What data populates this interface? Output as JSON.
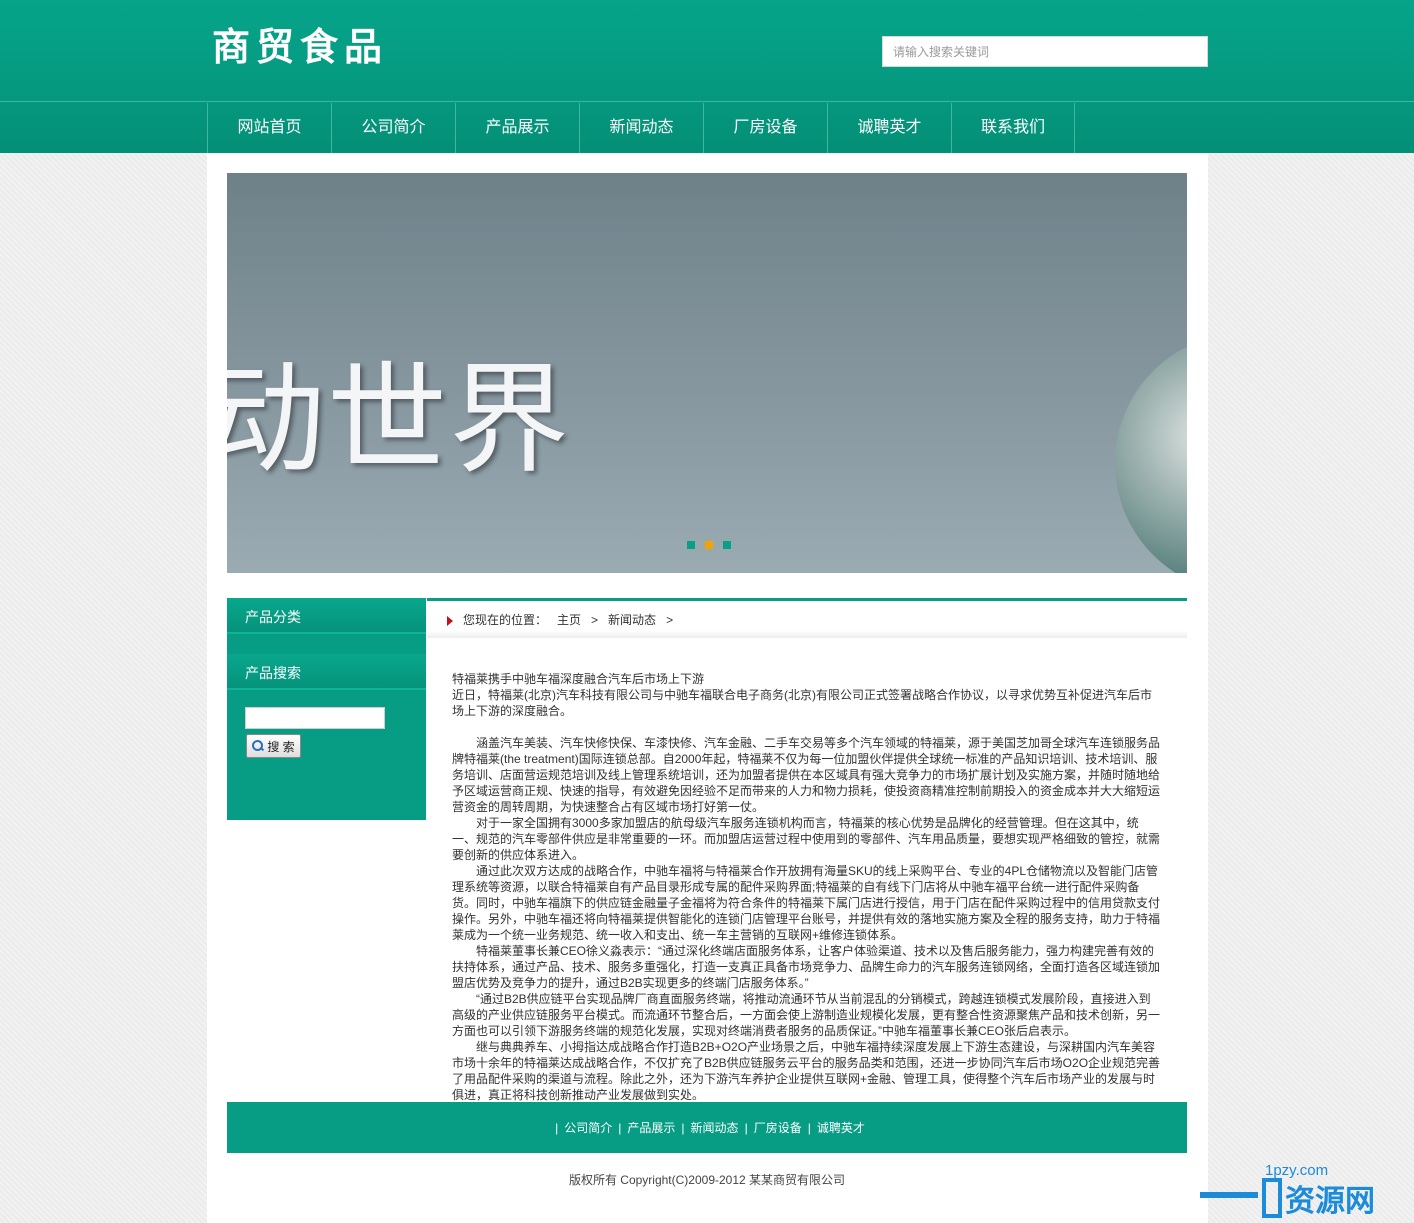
{
  "header": {
    "logo": "商贸食品",
    "search_placeholder": "请输入搜索关键词"
  },
  "nav": [
    "网站首页",
    "公司简介",
    "产品展示",
    "新闻动态",
    "厂房设备",
    "诚聘英才",
    "联系我们"
  ],
  "banner": {
    "text": "动世界",
    "slides": 3,
    "active_slide": 2
  },
  "sidebar": {
    "category_title": "产品分类",
    "search_title": "产品搜索",
    "search_button": "搜 索"
  },
  "breadcrumb": {
    "prefix": "您现在的位置：",
    "home": "主页",
    "sep1": ">",
    "section": "新闻动态",
    "sep2": ">"
  },
  "article": {
    "title": "特福莱携手中驰车福深度融合汽车后市场上下游",
    "lead": "近日，特福莱(北京)汽车科技有限公司与中驰车福联合电子商务(北京)有限公司正式签署战略合作协议，以寻求优势互补促进汽车后市场上下游的深度融合。",
    "p1": "涵盖汽车美装、汽车快修快保、车漆快修、汽车金融、二手车交易等多个汽车领域的特福莱，源于美国芝加哥全球汽车连锁服务品牌特福莱(the treatment)国际连锁总部。自2000年起，特福莱不仅为每一位加盟伙伴提供全球统一标准的产品知识培训、技术培训、服务培训、店面营运规范培训及线上管理系统培训，还为加盟者提供在本区域具有强大竞争力的市场扩展计划及实施方案，并随时随地给予区域运营商正规、快速的指导，有效避免因经验不足而带来的人力和物力损耗，使投资商精准控制前期投入的资金成本并大大缩短运营资金的周转周期，为快速整合占有区域市场打好第一仗。",
    "p2": "对于一家全国拥有3000多家加盟店的航母级汽车服务连锁机构而言，特福莱的核心优势是品牌化的经营管理。但在这其中，统一、规范的汽车零部件供应是非常重要的一环。而加盟店运营过程中使用到的零部件、汽车用品质量，要想实现严格细致的管控，就需要创新的供应体系进入。",
    "p3": "通过此次双方达成的战略合作，中驰车福将与特福莱合作开放拥有海量SKU的线上采购平台、专业的4PL仓储物流以及智能门店管理系统等资源，以联合特福莱自有产品目录形成专属的配件采购界面;特福莱的自有线下门店将从中驰车福平台统一进行配件采购备货。同时，中驰车福旗下的供应链金融量子金福将为符合条件的特福莱下属门店进行授信，用于门店在配件采购过程中的信用贷款支付操作。另外，中驰车福还将向特福莱提供智能化的连锁门店管理平台账号，并提供有效的落地实施方案及全程的服务支持，助力于特福莱成为一个统一业务规范、统一收入和支出、统一车主营销的互联网+维修连锁体系。",
    "p4": "特福莱董事长兼CEO徐义淼表示：“通过深化终端店面服务体系，让客户体验渠道、技术以及售后服务能力，强力构建完善有效的扶持体系，通过产品、技术、服务多重强化，打造一支真正具备市场竞争力、品牌生命力的汽车服务连锁网络，全面打造各区域连锁加盟店优势及竞争力的提升，通过B2B实现更多的终端门店服务体系。”",
    "p5": "“通过B2B供应链平台实现品牌厂商直面服务终端，将推动流通环节从当前混乱的分销模式，跨越连锁模式发展阶段，直接进入到高级的产业供应链服务平台模式。而流通环节整合后，一方面会使上游制造业规模化发展，更有整合性资源聚焦产品和技术创新，另一方面也可以引领下游服务终端的规范化发展，实现对终端消费者服务的品质保证。”中驰车福董事长兼CEO张后启表示。",
    "p6": "继与典典养车、小拇指达成战略合作打造B2B+O2O产业场景之后，中驰车福持续深度发展上下游生态建设，与深耕国内汽车美容市场十余年的特福莱达成战略合作，不仅扩充了B2B供应链服务云平台的服务品类和范围，还进一步协同汽车后市场O2O企业规范完善了用品配件采购的渠道与流程。除此之外，还为下游汽车养护企业提供互联网+金融、管理工具，使得整个汽车后市场产业的发展与时俱进，真正将科技创新推动产业发展做到实处。"
  },
  "footer": {
    "links": [
      "公司简介",
      "产品展示",
      "新闻动态",
      "厂房设备",
      "诚聘英才"
    ],
    "sep": "|",
    "copyright": "版权所有 Copyright(C)2009-2012 某某商贸有限公司"
  },
  "watermark": {
    "url": "1pzy.com",
    "text": "资源网"
  },
  "colors": {
    "brand_green": "#079c84",
    "active_dot": "#f2a500",
    "crumb_arrow": "#c0121a"
  }
}
